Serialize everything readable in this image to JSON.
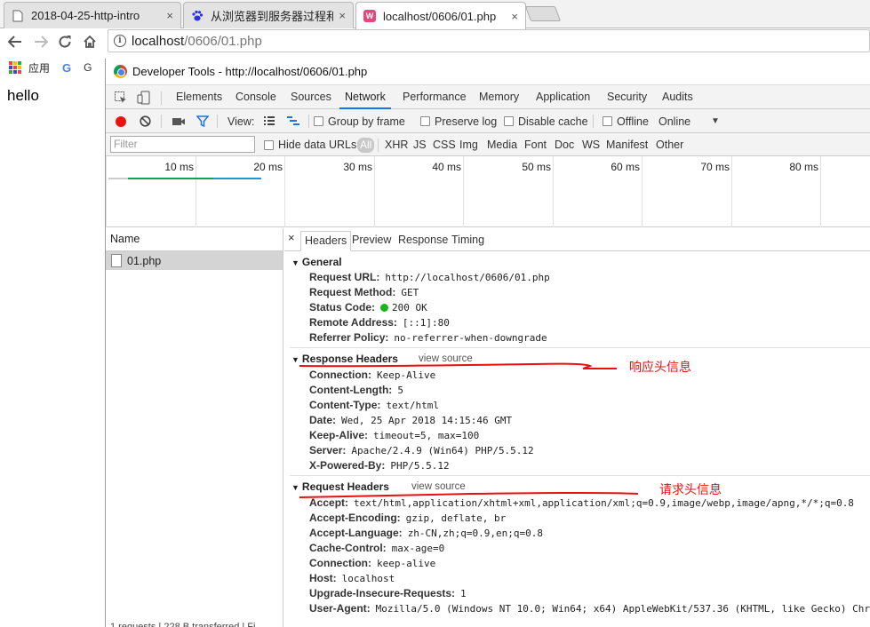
{
  "browser": {
    "tabs": [
      {
        "title": "2018-04-25-http-intro",
        "icon": "doc-icon",
        "active": false
      },
      {
        "title": "从浏览器到服务器过程和",
        "icon": "baidu-paw-icon",
        "active": false
      },
      {
        "title": "localhost/0606/01.php",
        "icon": "php-icon",
        "active": true
      }
    ],
    "close_glyph": "×",
    "url_host": "localhost",
    "url_path": "/0606/01.php",
    "info_glyph": "i",
    "bookmarks": {
      "apps_label": "应用",
      "g1": "G",
      "g2": "G"
    }
  },
  "page": {
    "text": "hello",
    "footer": ""
  },
  "devtools": {
    "title": "Developer Tools - http://localhost/0606/01.php",
    "tabs": [
      "Elements",
      "Console",
      "Sources",
      "Network",
      "Performance",
      "Memory",
      "Application",
      "Security",
      "Audits"
    ],
    "active_tab": "Network",
    "toolbar": {
      "view_label": "View:",
      "group_by_frame": "Group by frame",
      "preserve_log": "Preserve log",
      "disable_cache": "Disable cache",
      "offline": "Offline",
      "throttle": "Online"
    },
    "filter": {
      "placeholder": "Filter",
      "hide_data_urls": "Hide data URLs",
      "all": "All",
      "types": [
        "XHR",
        "JS",
        "CSS",
        "Img",
        "Media",
        "Font",
        "Doc",
        "WS",
        "Manifest",
        "Other"
      ]
    },
    "timeline": {
      "ticks": [
        "10 ms",
        "20 ms",
        "30 ms",
        "40 ms",
        "50 ms",
        "60 ms",
        "70 ms",
        "80 ms"
      ]
    },
    "requests": {
      "header": "Name",
      "rows": [
        {
          "name": "01.php"
        }
      ],
      "status": "1 requests | 228 B transferred | Fi"
    },
    "detail": {
      "close": "×",
      "tabs": [
        "Headers",
        "Preview",
        "Response",
        "Timing"
      ],
      "active": "Headers",
      "general": {
        "title": "General",
        "rows": [
          {
            "k": "Request URL:",
            "v": "http://localhost/0606/01.php"
          },
          {
            "k": "Request Method:",
            "v": "GET"
          },
          {
            "k": "Status Code:",
            "v": "200 OK"
          },
          {
            "k": "Remote Address:",
            "v": "[::1]:80"
          },
          {
            "k": "Referrer Policy:",
            "v": "no-referrer-when-downgrade"
          }
        ]
      },
      "response": {
        "title": "Response Headers",
        "view_source": "view source",
        "rows": [
          {
            "k": "Connection:",
            "v": "Keep-Alive"
          },
          {
            "k": "Content-Length:",
            "v": "5"
          },
          {
            "k": "Content-Type:",
            "v": "text/html"
          },
          {
            "k": "Date:",
            "v": "Wed, 25 Apr 2018 14:15:46 GMT"
          },
          {
            "k": "Keep-Alive:",
            "v": "timeout=5, max=100"
          },
          {
            "k": "Server:",
            "v": "Apache/2.4.9 (Win64) PHP/5.5.12"
          },
          {
            "k": "X-Powered-By:",
            "v": "PHP/5.5.12"
          }
        ]
      },
      "request": {
        "title": "Request Headers",
        "view_source": "view source",
        "rows": [
          {
            "k": "Accept:",
            "v": "text/html,application/xhtml+xml,application/xml;q=0.9,image/webp,image/apng,*/*;q=0.8"
          },
          {
            "k": "Accept-Encoding:",
            "v": "gzip, deflate, br"
          },
          {
            "k": "Accept-Language:",
            "v": "zh-CN,zh;q=0.9,en;q=0.8"
          },
          {
            "k": "Cache-Control:",
            "v": "max-age=0"
          },
          {
            "k": "Connection:",
            "v": "keep-alive"
          },
          {
            "k": "Host:",
            "v": "localhost"
          },
          {
            "k": "Upgrade-Insecure-Requests:",
            "v": "1"
          },
          {
            "k": "User-Agent:",
            "v": "Mozilla/5.0 (Windows NT 10.0; Win64; x64) AppleWebKit/537.36 (KHTML, like Gecko) Chro"
          }
        ]
      }
    }
  },
  "annotations": {
    "response": "响应头信息",
    "request": "请求头信息",
    "color": "#e8100e"
  }
}
